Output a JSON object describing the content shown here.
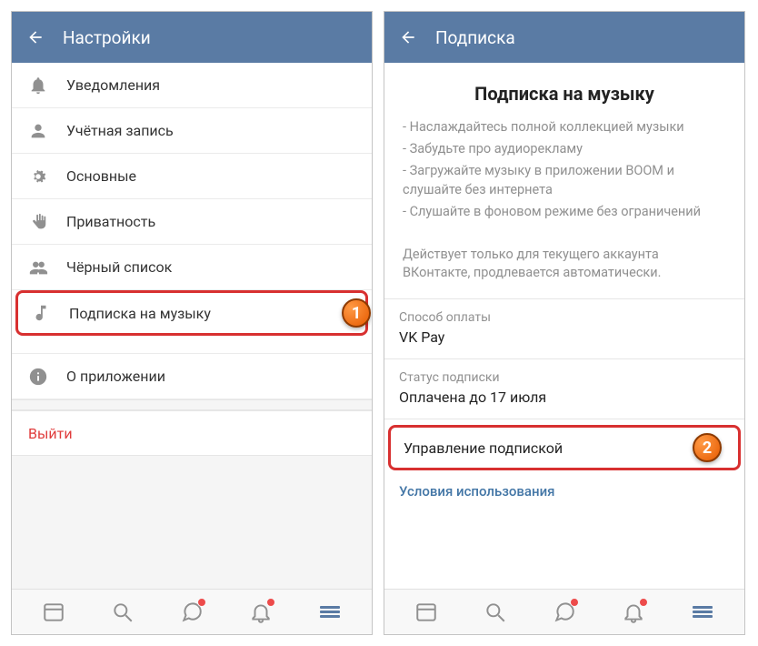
{
  "left": {
    "appbar_title": "Настройки",
    "items": {
      "notifications": "Уведомления",
      "account": "Учётная запись",
      "general": "Основные",
      "privacy": "Приватность",
      "blacklist": "Чёрный список",
      "music_sub": "Подписка на музыку",
      "about": "О приложении"
    },
    "exit": "Выйти",
    "badge": "1"
  },
  "right": {
    "appbar_title": "Подписка",
    "heading": "Подписка на музыку",
    "bullets": [
      "- Наслаждайтесь полной коллекцией музыки",
      "- Забудьте про аудиорекламу",
      "- Загружайте музыку в приложении BOOM и слушайте без интернета",
      "- Слушайте в фоновом режиме без ограничений"
    ],
    "note": "Действует только для текущего аккаунта ВКонтакте, продлевается автоматически.",
    "payment_label": "Способ оплаты",
    "payment_value": "VK Pay",
    "status_label": "Статус подписки",
    "status_value": "Оплачена до 17 июля",
    "manage": "Управление подпиской",
    "terms": "Условия использования",
    "badge": "2"
  }
}
